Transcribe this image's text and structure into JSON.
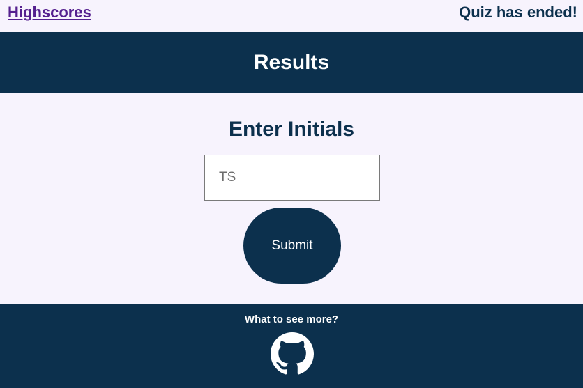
{
  "header": {
    "highscores_label": "Highscores",
    "status_text": "Quiz has ended!"
  },
  "banner": {
    "title": "Results"
  },
  "form": {
    "heading": "Enter Initials",
    "initials_placeholder": "TS",
    "initials_value": "",
    "submit_label": "Submit"
  },
  "footer": {
    "prompt_text": "What to see more?",
    "icon": "github-icon"
  },
  "colors": {
    "primary": "#0c304d",
    "background": "#f7f3fd",
    "link": "#55208f"
  }
}
